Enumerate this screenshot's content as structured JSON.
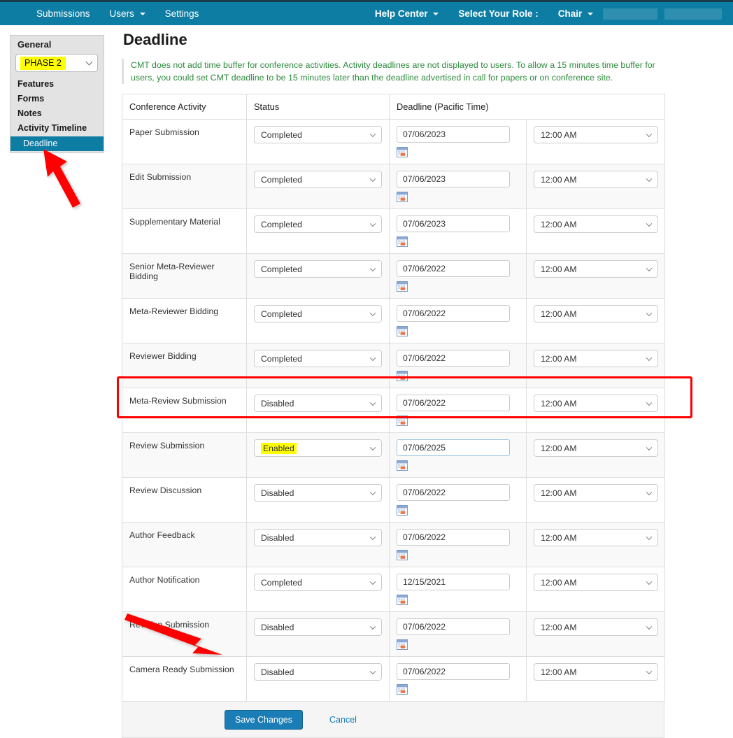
{
  "topbar": {
    "left_items": [
      {
        "label": "Submissions",
        "has_caret": false,
        "bold": false
      },
      {
        "label": "Users",
        "has_caret": true,
        "bold": false
      },
      {
        "label": "Settings",
        "has_caret": false,
        "bold": false
      }
    ],
    "right_items": [
      {
        "label": "Help Center",
        "has_caret": true,
        "bold": true
      },
      {
        "label": "Select Your Role :",
        "has_caret": false,
        "bold": true
      },
      {
        "label": "Chair",
        "has_caret": true,
        "bold": true
      }
    ],
    "background_color": "#0e7da4"
  },
  "sidebar": {
    "heading": "General",
    "phase_select": {
      "value": "PHASE 2",
      "highlight_color": "#ffff00"
    },
    "items": [
      {
        "label": "Features",
        "selected": false
      },
      {
        "label": "Forms",
        "selected": false
      },
      {
        "label": "Notes",
        "selected": false
      },
      {
        "label": "Activity Timeline",
        "selected": false
      },
      {
        "label": "Deadline",
        "selected": true
      }
    ],
    "selected_color": "#0e7da4"
  },
  "main": {
    "title": "Deadline",
    "info_note": "CMT does not add time buffer for conference activities. Activity deadlines are not displayed to users. To allow a 15 minutes time buffer for users, you could set CMT deadline to be 15 minutes later than the deadline advertised in call for papers or on conference site.",
    "info_note_color": "#2e8b3d",
    "table": {
      "columns": [
        "Conference Activity",
        "Status",
        "Deadline (Pacific Time)",
        ""
      ],
      "rows": [
        {
          "activity": "Paper Submission",
          "status": "Completed",
          "date": "07/06/2023",
          "time": "12:00 AM",
          "highlighted": false
        },
        {
          "activity": "Edit Submission",
          "status": "Completed",
          "date": "07/06/2023",
          "time": "12:00 AM",
          "highlighted": false
        },
        {
          "activity": "Supplementary Material",
          "status": "Completed",
          "date": "07/06/2023",
          "time": "12:00 AM",
          "highlighted": false
        },
        {
          "activity": "Senior Meta-Reviewer Bidding",
          "status": "Completed",
          "date": "07/06/2022",
          "time": "12:00 AM",
          "highlighted": false
        },
        {
          "activity": "Meta-Reviewer Bidding",
          "status": "Completed",
          "date": "07/06/2022",
          "time": "12:00 AM",
          "highlighted": false
        },
        {
          "activity": "Reviewer Bidding",
          "status": "Completed",
          "date": "07/06/2022",
          "time": "12:00 AM",
          "highlighted": false
        },
        {
          "activity": "Meta-Review Submission",
          "status": "Disabled",
          "date": "07/06/2022",
          "time": "12:00 AM",
          "highlighted": false
        },
        {
          "activity": "Review Submission",
          "status": "Enabled",
          "date": "07/06/2025",
          "time": "12:00 AM",
          "highlighted": true
        },
        {
          "activity": "Review Discussion",
          "status": "Disabled",
          "date": "07/06/2022",
          "time": "12:00 AM",
          "highlighted": false
        },
        {
          "activity": "Author Feedback",
          "status": "Disabled",
          "date": "07/06/2022",
          "time": "12:00 AM",
          "highlighted": false
        },
        {
          "activity": "Author Notification",
          "status": "Completed",
          "date": "12/15/2021",
          "time": "12:00 AM",
          "highlighted": false
        },
        {
          "activity": "Revision Submission",
          "status": "Disabled",
          "date": "07/06/2022",
          "time": "12:00 AM",
          "highlighted": false
        },
        {
          "activity": "Camera Ready Submission",
          "status": "Disabled",
          "date": "07/06/2022",
          "time": "12:00 AM",
          "highlighted": false
        }
      ]
    },
    "footer": {
      "save_label": "Save Changes",
      "cancel_label": "Cancel",
      "save_color": "#1a7db5"
    }
  },
  "annotations": {
    "highlight_rect_color": "#ff0000",
    "arrow_color": "#ff0000"
  }
}
